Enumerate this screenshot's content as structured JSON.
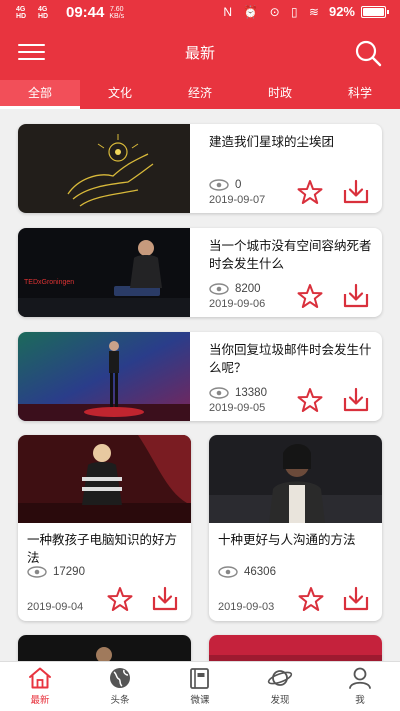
{
  "status_bar": {
    "signal_1": "4G HD",
    "signal_2": "4G HD",
    "time": "09:44",
    "speed_value": "7.60",
    "speed_unit": "KB/s",
    "icons": "N ⏰ ⊙ ▯ ≋",
    "battery_percent": "92%",
    "battery_level": 0.92
  },
  "header": {
    "title": "最新",
    "menu_icon": "menu-icon",
    "search_icon": "search-icon"
  },
  "tabs": [
    {
      "label": "全部",
      "active": true
    },
    {
      "label": "文化",
      "active": false
    },
    {
      "label": "经济",
      "active": false
    },
    {
      "label": "时政",
      "active": false
    },
    {
      "label": "科学",
      "active": false
    }
  ],
  "list_items": [
    {
      "title": "建造我们星球的尘埃团",
      "views": "0",
      "date": "2019-09-07"
    },
    {
      "title": "当一个城市没有空间容纳死者时会发生什么",
      "views": "8200",
      "date": "2019-09-06",
      "caption": "TEDxGroningen"
    },
    {
      "title": "当你回复垃圾邮件时会发生什么呢？",
      "views": "13380",
      "date": "2019-09-05"
    }
  ],
  "grid_items": [
    {
      "title": "一种教孩子电脑知识的好方法",
      "views": "17290",
      "date": "2019-09-04"
    },
    {
      "title": "十种更好与人沟通的方法",
      "views": "46306",
      "date": "2019-09-03"
    }
  ],
  "nav": [
    {
      "label": "最新",
      "icon": "home-icon",
      "active": true
    },
    {
      "label": "头条",
      "icon": "globe-icon",
      "active": false
    },
    {
      "label": "微课",
      "icon": "book-icon",
      "active": false
    },
    {
      "label": "发现",
      "icon": "planet-icon",
      "active": false
    },
    {
      "label": "我",
      "icon": "user-icon",
      "active": false
    }
  ],
  "colors": {
    "brand_red": "#e8343f",
    "tab_active_bg": "#f24f59",
    "icon_red": "#d9303c"
  }
}
